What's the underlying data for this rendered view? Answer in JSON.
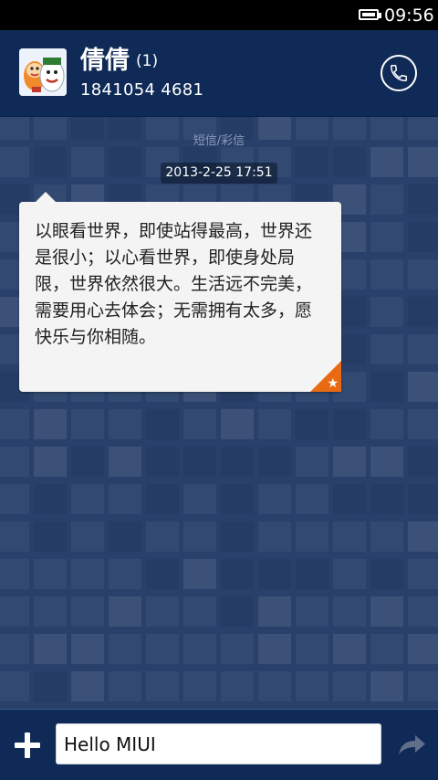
{
  "status_bar": {
    "time": "09:56",
    "battery_icon": "battery-icon"
  },
  "header": {
    "contact_name": "倩倩",
    "unread_count": "(1)",
    "phone_number": "1841054 4681",
    "avatar_icon": "cartoon-avatar",
    "call_icon": "phone-icon"
  },
  "thread": {
    "message_type": "短信/彩信",
    "timestamp": "2013-2-25 17:51",
    "message": {
      "text": "以眼看世界，即使站得最高，世界还是很小；以心看世界，即使身处局限，世界依然很大。生活远不完美，需要用心去体会；无需拥有太多，愿快乐与你相随。",
      "favorite_icon": "star-icon"
    }
  },
  "composer": {
    "input_value": "Hello MIUI",
    "add_icon": "plus-icon",
    "send_icon": "send-arrow-icon"
  },
  "colors": {
    "header_bg": "#0f2a57",
    "thread_bg": "#28406a",
    "bubble_bg": "#f4f4f4",
    "star_badge": "#e96a12"
  }
}
